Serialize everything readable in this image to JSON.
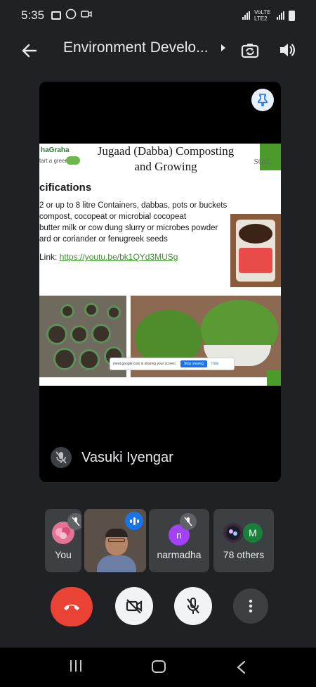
{
  "status_bar": {
    "time": "5:35",
    "network": "VoLTE LTE2",
    "battery": "full"
  },
  "header": {
    "title": "Environment Develo...",
    "back_icon": "arrow-left-icon",
    "camera_switch_icon": "camera-switch-icon",
    "speaker_icon": "speaker-icon"
  },
  "main_stage": {
    "presenter_name": "Vasuki Iyengar",
    "pin_icon": "pin-icon",
    "slide": {
      "logo": "haGraha",
      "logo_sub": "tart a green",
      "title_line1": "Jugaad (Dabba) Composting",
      "title_line2": "and Growing",
      "soil_label": "SOIL",
      "spec_heading": "cifications",
      "spec_lines": [
        "2 or up to 8 litre Containers, dabbas, pots or buckets",
        "compost, cocopeat or microbial  cocopeat",
        "butter milk or cow dung slurry or microbes powder",
        "ard or coriander or fenugreek seeds"
      ],
      "link_prefix": "Link:",
      "link_url": "https://youtu.be/bk1QYd3MUSg",
      "share_notice": "meet.google.com is sharing your screen.",
      "share_stop": "Stop sharing",
      "share_hide": "Hide"
    }
  },
  "participants": [
    {
      "label": "You",
      "mic": "muted"
    },
    {
      "label": "",
      "speaking": true
    },
    {
      "label": "narmadha",
      "initial": "n",
      "mic": "muted"
    },
    {
      "label": "78 others",
      "initial": "M"
    }
  ],
  "controls": {
    "end_call": "end-call-icon",
    "camera": "camera-off-icon",
    "mic": "mic-off-icon",
    "more": "more-vert-icon"
  },
  "colors": {
    "background": "#202124",
    "tile": "#3c4043",
    "end_call": "#ea4335",
    "accent": "#1a73e8",
    "narmadha_avatar": "#a142f4",
    "m_avatar": "#188038"
  }
}
